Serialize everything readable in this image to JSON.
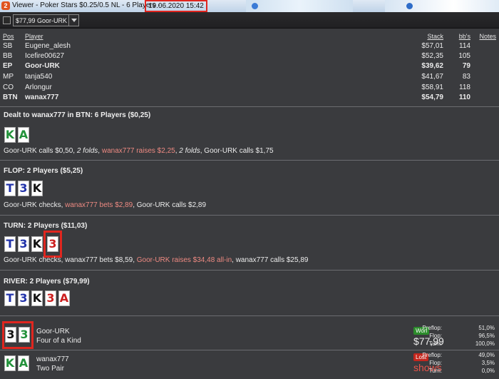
{
  "window": {
    "title": "Viewer - Poker Stars $0.25/0.5 NL - 6 Players -",
    "datetime": "19.06.2020 15:42",
    "app_icon": "2"
  },
  "toolbar": {
    "player_select_value": "$77,99 Goor-URK"
  },
  "table_headers": {
    "pos": "Pos",
    "player": "Player",
    "stack": "Stack",
    "bbs": "bb's",
    "notes": "Notes"
  },
  "players": [
    {
      "pos": "SB",
      "name": "Eugene_alesh",
      "stack": "$57,01",
      "bbs": "114"
    },
    {
      "pos": "BB",
      "name": "Icefire00627",
      "stack": "$52,35",
      "bbs": "105"
    },
    {
      "pos": "EP",
      "name": "Goor-URK",
      "stack": "$39,62",
      "bbs": "79"
    },
    {
      "pos": "MP",
      "name": "tanja540",
      "stack": "$41,67",
      "bbs": "83"
    },
    {
      "pos": "CO",
      "name": "Arlongur",
      "stack": "$58,91",
      "bbs": "118"
    },
    {
      "pos": "BTN",
      "name": "wanax777",
      "stack": "$54,79",
      "bbs": "110"
    }
  ],
  "preflop": {
    "title": "Dealt to wanax777 in BTN: 6 Players ($0,25)",
    "cards": [
      {
        "rank": "K",
        "suit": "c"
      },
      {
        "rank": "A",
        "suit": "c"
      }
    ],
    "actions": {
      "a1": "Goor-URK calls $0,50, ",
      "a2": "2 folds",
      "a3": ", ",
      "a4": "wanax777 raises $2,25",
      "a5": ", ",
      "a6": "2 folds",
      "a7": ", Goor-URK calls $1,75"
    }
  },
  "flop": {
    "title": "FLOP: 2 Players ($5,25)",
    "cards": [
      {
        "rank": "T",
        "suit": "d"
      },
      {
        "rank": "3",
        "suit": "d"
      },
      {
        "rank": "K",
        "suit": "s"
      }
    ],
    "actions": {
      "a1": "Goor-URK checks, ",
      "a2": "wanax777 bets $2,89",
      "a3": ", Goor-URK calls $2,89"
    }
  },
  "turn": {
    "title": "TURN: 2 Players ($11,03)",
    "cards": [
      {
        "rank": "T",
        "suit": "d"
      },
      {
        "rank": "3",
        "suit": "d"
      },
      {
        "rank": "K",
        "suit": "s"
      },
      {
        "rank": "3",
        "suit": "h"
      }
    ],
    "actions": {
      "a1": "Goor-URK checks, wanax777 bets $8,59, ",
      "a2": "Goor-URK raises $34,48 all-in",
      "a3": ", wanax777 calls $25,89"
    }
  },
  "river": {
    "title": "RIVER: 2 Players ($79,99)",
    "cards": [
      {
        "rank": "T",
        "suit": "d"
      },
      {
        "rank": "3",
        "suit": "d"
      },
      {
        "rank": "K",
        "suit": "s"
      },
      {
        "rank": "3",
        "suit": "h"
      },
      {
        "rank": "A",
        "suit": "h"
      }
    ]
  },
  "showdown": [
    {
      "name": "Goor-URK",
      "hand": "Four of a Kind",
      "cards": [
        {
          "rank": "3",
          "suit": "s"
        },
        {
          "rank": "3",
          "suit": "c"
        }
      ],
      "result": "Won",
      "amount": "$77,99",
      "equity": {
        "preflop_label": "Preflop:",
        "preflop": "51,0%",
        "flop_label": "Flop:",
        "flop": "96,5%",
        "turn_label": "Turn:",
        "turn": "100,0%"
      }
    },
    {
      "name": "wanax777",
      "hand": "Two Pair",
      "cards": [
        {
          "rank": "K",
          "suit": "c"
        },
        {
          "rank": "A",
          "suit": "c"
        }
      ],
      "result": "Lost",
      "amount": "shows",
      "equity": {
        "preflop_label": "Preflop:",
        "preflop": "49,0%",
        "flop_label": "Flop:",
        "flop": "3,5%",
        "turn_label": "Turn:",
        "turn": "0,0%"
      }
    }
  ],
  "colors": {
    "background": "#3a3b3e",
    "highlight_action": "#ee8a82",
    "won": "#2c8c2c",
    "lost": "#c3261d",
    "annotation_box": "#e0261f"
  }
}
